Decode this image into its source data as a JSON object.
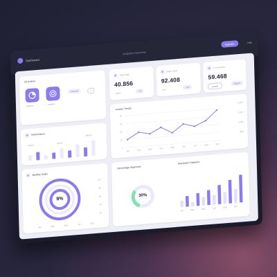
{
  "topbar": {
    "brand": "Dashboard",
    "title": "Analytics Overview",
    "upgrade_label": "Upgrade",
    "link_label": "Help"
  },
  "actions": {
    "title": "All Actions",
    "tile1_label": "Reports",
    "tile2_label": "Insights",
    "pill_label": "View all"
  },
  "stats": {
    "stat1": {
      "label": "Total Visits",
      "value": "40.856",
      "tag": "+12%",
      "tag2": "+8"
    },
    "stat2": {
      "label": "Page Views",
      "value": "92.408",
      "tag": "+24",
      "tag2": "+16"
    },
    "stat3": {
      "label": "Conversions",
      "value": "59.468",
      "tag": "Details",
      "button": "Export"
    }
  },
  "bars_card": {
    "title": "Performance",
    "labels": [
      "338 %",
      "640 %",
      "858 %"
    ],
    "values": [
      12,
      18,
      9,
      14,
      22,
      16,
      28,
      20,
      34
    ]
  },
  "line_chart": {
    "title": "Activity Trends",
    "y_ticks": [
      "40",
      "30",
      "20",
      "10",
      "0"
    ],
    "x_labels": [
      "Jan",
      "Feb",
      "Mar",
      "Apr",
      "May",
      "Jun",
      "Jul",
      "Aug",
      "Sep"
    ],
    "values": [
      10,
      18,
      15,
      22,
      14,
      24,
      20,
      26,
      38
    ],
    "right_labels": [
      "1,250",
      "1,125",
      "1,500",
      "980"
    ]
  },
  "progress_card": {
    "title": "Monthly Goals",
    "percent": 0.09,
    "center_label": "9%",
    "y_ticks": [
      "100",
      "80",
      "60",
      "40",
      "20"
    ],
    "x_labels": [
      "Jan",
      "Mar",
      "May",
      "Jul",
      "Sep"
    ]
  },
  "donut_card": {
    "title": "Percentage Segments",
    "percent": 0.3,
    "center_label": "30%"
  },
  "column_card": {
    "title": "Resolution Statistics",
    "values": [
      6,
      10,
      4,
      12,
      8,
      14,
      9,
      18,
      11,
      22,
      13,
      26
    ],
    "x_labels": [
      "Jan",
      "Mar",
      "May",
      "Jul",
      "Sep",
      "Nov"
    ]
  },
  "colors": {
    "accent": "#8a7cf0",
    "accent_light": "#ece9fd",
    "ring_green": "#7fe3b4"
  }
}
